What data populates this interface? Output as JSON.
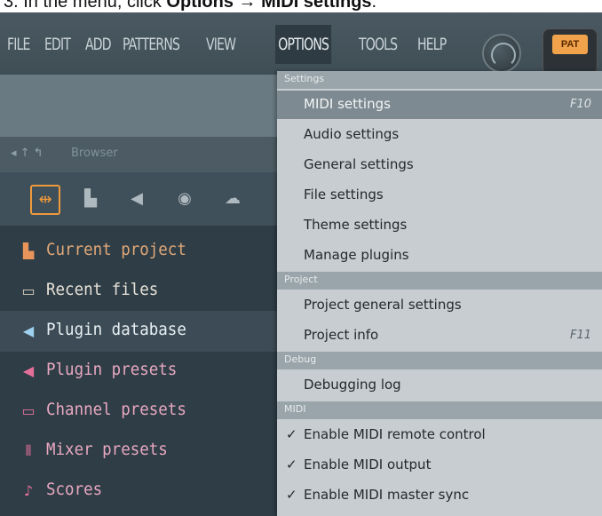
{
  "caption": {
    "prefix": "3. In the menu, click ",
    "bold1": "Options",
    "sep": " → ",
    "bold2": "MIDI settings",
    "suffix": "."
  },
  "menubar": {
    "items": [
      "FILE",
      "EDIT",
      "ADD",
      "PATTERNS",
      "VIEW",
      "OPTIONS",
      "TOOLS",
      "HELP"
    ],
    "active": "OPTIONS",
    "pat_label": "PAT"
  },
  "browser": {
    "header_nav": "◂ ↑ ↰",
    "header_title": "Browser",
    "items": [
      {
        "label": "Current project",
        "color": "#e0a878",
        "icon_color": "#e8945a",
        "icon": "▙"
      },
      {
        "label": "Recent files",
        "color": "#e7e2d8",
        "icon_color": "#d8cfbf",
        "icon": "▭"
      },
      {
        "label": "Plugin database",
        "color": "#e8f0f4",
        "icon_color": "#9ed0f0",
        "icon": "◀"
      },
      {
        "label": "Plugin presets",
        "color": "#e8a8c0",
        "icon_color": "#e4709a",
        "icon": "◀"
      },
      {
        "label": "Channel presets",
        "color": "#e8a8c0",
        "icon_color": "#e4709a",
        "icon": "▭"
      },
      {
        "label": "Mixer presets",
        "color": "#e8a8c0",
        "icon_color": "#e4709a",
        "icon": "⫴"
      },
      {
        "label": "Scores",
        "color": "#e8a8c0",
        "icon_color": "#e4709a",
        "icon": "♪"
      }
    ]
  },
  "dropdown": {
    "sections": [
      {
        "title": "Settings",
        "items": [
          {
            "label": "MIDI settings",
            "shortcut": "F10",
            "hover": true
          },
          {
            "label": "Audio settings",
            "shortcut": ""
          },
          {
            "label": "General settings",
            "shortcut": ""
          },
          {
            "label": "File settings",
            "shortcut": ""
          },
          {
            "label": "Theme settings",
            "shortcut": ""
          },
          {
            "label": "Manage plugins",
            "shortcut": ""
          }
        ]
      },
      {
        "title": "Project",
        "items": [
          {
            "label": "Project general settings",
            "shortcut": ""
          },
          {
            "label": "Project info",
            "shortcut": "F11"
          }
        ]
      },
      {
        "title": "Debug",
        "items": [
          {
            "label": "Debugging log",
            "shortcut": ""
          }
        ]
      },
      {
        "title": "MIDI",
        "items": [
          {
            "label": "Enable MIDI remote control",
            "checked": true
          },
          {
            "label": "Enable MIDI output",
            "checked": true
          },
          {
            "label": "Enable MIDI master sync",
            "checked": true
          }
        ]
      }
    ]
  }
}
